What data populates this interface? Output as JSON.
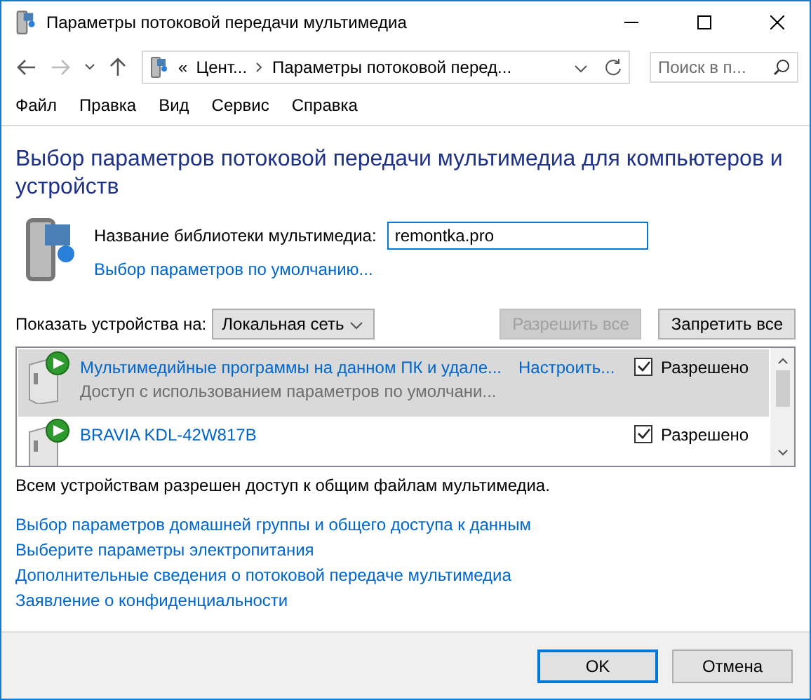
{
  "window": {
    "title": "Параметры потоковой передачи мультимедиа"
  },
  "address_bar": {
    "chevron": "«",
    "crumbs": [
      "Цент...",
      "Параметры потоковой перед..."
    ]
  },
  "search": {
    "placeholder": "Поиск в п..."
  },
  "menu": [
    "Файл",
    "Правка",
    "Вид",
    "Сервис",
    "Справка"
  ],
  "heading": "Выбор параметров потоковой передачи мультимедиа для компьютеров и устройств",
  "library": {
    "label": "Название библиотеки мультимедиа:",
    "value": "remontka.pro",
    "defaults_link": "Выбор параметров по умолчанию..."
  },
  "show_devices": {
    "label": "Показать устройства на:",
    "value": "Локальная сеть"
  },
  "buttons_top": [
    {
      "label": "Разрешить все",
      "disabled": true
    },
    {
      "label": "Запретить все",
      "disabled": false
    }
  ],
  "devices": [
    {
      "name": "Мультимедийные программы на данном ПК и удале...",
      "subtitle": "Доступ с использованием параметров по умолчани...",
      "customize": "Настроить...",
      "status": "Разрешено",
      "checked": true,
      "selected": true
    },
    {
      "name": "BRAVIA KDL-42W817B",
      "status": "Разрешено",
      "checked": true,
      "selected": false
    }
  ],
  "summary": "Всем устройствам разрешен доступ к общим файлам мультимедиа.",
  "links": [
    "Выбор параметров домашней группы и общего доступа к данным",
    "Выберите параметры электропитания",
    "Дополнительные сведения о потоковой передаче мультимедиа",
    "Заявление о конфиденциальности"
  ],
  "footer_buttons": [
    "OK",
    "Отмена"
  ]
}
